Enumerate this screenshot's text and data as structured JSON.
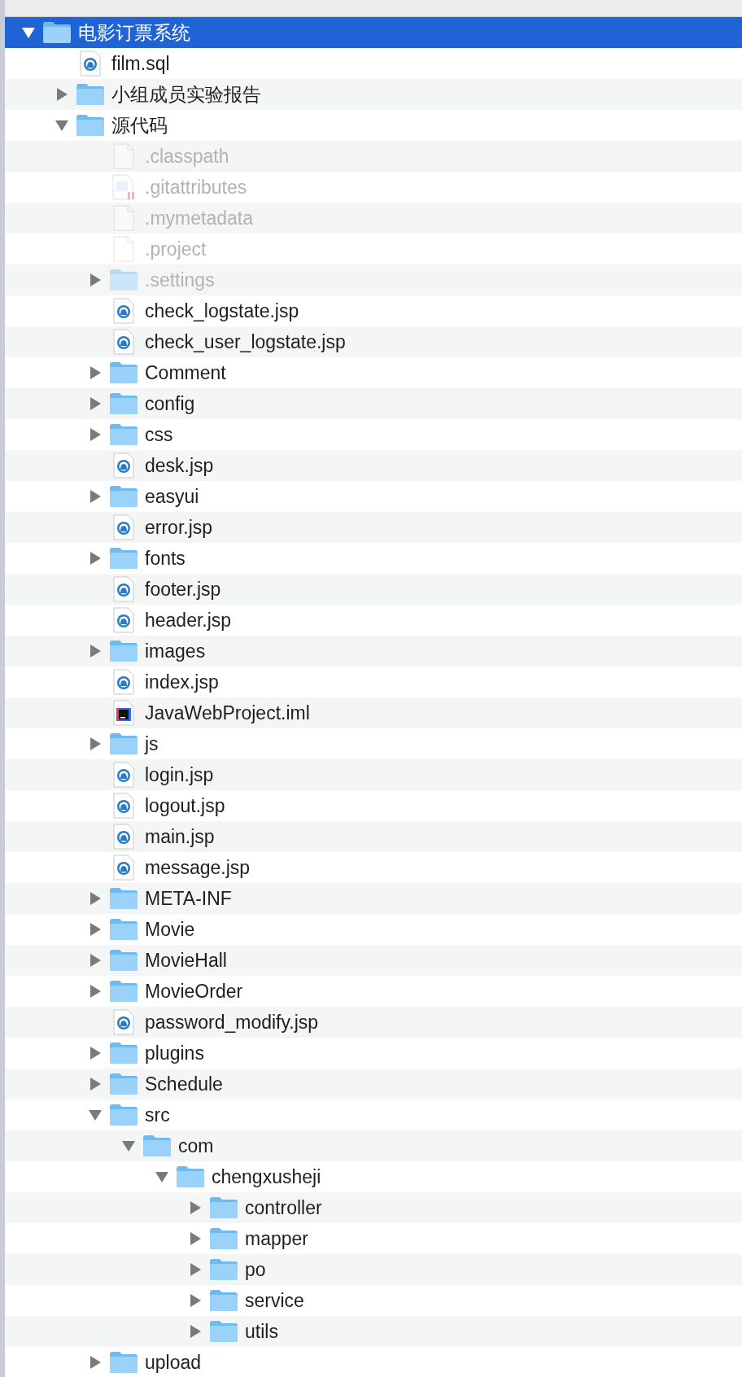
{
  "tree": [
    {
      "name": "电影订票系统",
      "kind": "folder",
      "expanded": true,
      "selected": true,
      "children": [
        {
          "name": "film.sql",
          "kind": "web",
          "selected": false
        },
        {
          "name": "小组成员实验报告",
          "kind": "folder",
          "expanded": false,
          "selected": false
        },
        {
          "name": "源代码",
          "kind": "folder",
          "expanded": true,
          "selected": false,
          "children": [
            {
              "name": ".classpath",
              "kind": "blank",
              "hidden": true,
              "selected": false
            },
            {
              "name": ".gitattributes",
              "kind": "text",
              "hidden": true,
              "selected": false
            },
            {
              "name": ".mymetadata",
              "kind": "blank",
              "hidden": true,
              "selected": false
            },
            {
              "name": ".project",
              "kind": "blank",
              "hidden": true,
              "selected": false
            },
            {
              "name": ".settings",
              "kind": "folder",
              "hidden": true,
              "expanded": false,
              "selected": false
            },
            {
              "name": "check_logstate.jsp",
              "kind": "web",
              "selected": false
            },
            {
              "name": "check_user_logstate.jsp",
              "kind": "web",
              "selected": false
            },
            {
              "name": "Comment",
              "kind": "folder",
              "expanded": false,
              "selected": false
            },
            {
              "name": "config",
              "kind": "folder",
              "expanded": false,
              "selected": false
            },
            {
              "name": "css",
              "kind": "folder",
              "expanded": false,
              "selected": false
            },
            {
              "name": "desk.jsp",
              "kind": "web",
              "selected": false
            },
            {
              "name": "easyui",
              "kind": "folder",
              "expanded": false,
              "selected": false
            },
            {
              "name": "error.jsp",
              "kind": "web",
              "selected": false
            },
            {
              "name": "fonts",
              "kind": "folder",
              "expanded": false,
              "selected": false
            },
            {
              "name": "footer.jsp",
              "kind": "web",
              "selected": false
            },
            {
              "name": "header.jsp",
              "kind": "web",
              "selected": false
            },
            {
              "name": "images",
              "kind": "folder",
              "expanded": false,
              "selected": false
            },
            {
              "name": "index.jsp",
              "kind": "web",
              "selected": false
            },
            {
              "name": "JavaWebProject.iml",
              "kind": "ide",
              "selected": false
            },
            {
              "name": "js",
              "kind": "folder",
              "expanded": false,
              "selected": false
            },
            {
              "name": "login.jsp",
              "kind": "web",
              "selected": false
            },
            {
              "name": "logout.jsp",
              "kind": "web",
              "selected": false
            },
            {
              "name": "main.jsp",
              "kind": "web",
              "selected": false
            },
            {
              "name": "message.jsp",
              "kind": "web",
              "selected": false
            },
            {
              "name": "META-INF",
              "kind": "folder",
              "expanded": false,
              "selected": false
            },
            {
              "name": "Movie",
              "kind": "folder",
              "expanded": false,
              "selected": false
            },
            {
              "name": "MovieHall",
              "kind": "folder",
              "expanded": false,
              "selected": false
            },
            {
              "name": "MovieOrder",
              "kind": "folder",
              "expanded": false,
              "selected": false
            },
            {
              "name": "password_modify.jsp",
              "kind": "web",
              "selected": false
            },
            {
              "name": "plugins",
              "kind": "folder",
              "expanded": false,
              "selected": false
            },
            {
              "name": "Schedule",
              "kind": "folder",
              "expanded": false,
              "selected": false
            },
            {
              "name": "src",
              "kind": "folder",
              "expanded": true,
              "selected": false,
              "children": [
                {
                  "name": "com",
                  "kind": "folder",
                  "expanded": true,
                  "selected": false,
                  "children": [
                    {
                      "name": "chengxusheji",
                      "kind": "folder",
                      "expanded": true,
                      "selected": false,
                      "children": [
                        {
                          "name": "controller",
                          "kind": "folder",
                          "expanded": false,
                          "selected": false
                        },
                        {
                          "name": "mapper",
                          "kind": "folder",
                          "expanded": false,
                          "selected": false
                        },
                        {
                          "name": "po",
                          "kind": "folder",
                          "expanded": false,
                          "selected": false
                        },
                        {
                          "name": "service",
                          "kind": "folder",
                          "expanded": false,
                          "selected": false
                        },
                        {
                          "name": "utils",
                          "kind": "folder",
                          "expanded": false,
                          "selected": false
                        }
                      ]
                    }
                  ]
                }
              ]
            },
            {
              "name": "upload",
              "kind": "folder",
              "expanded": false,
              "selected": false
            }
          ]
        }
      ]
    }
  ]
}
